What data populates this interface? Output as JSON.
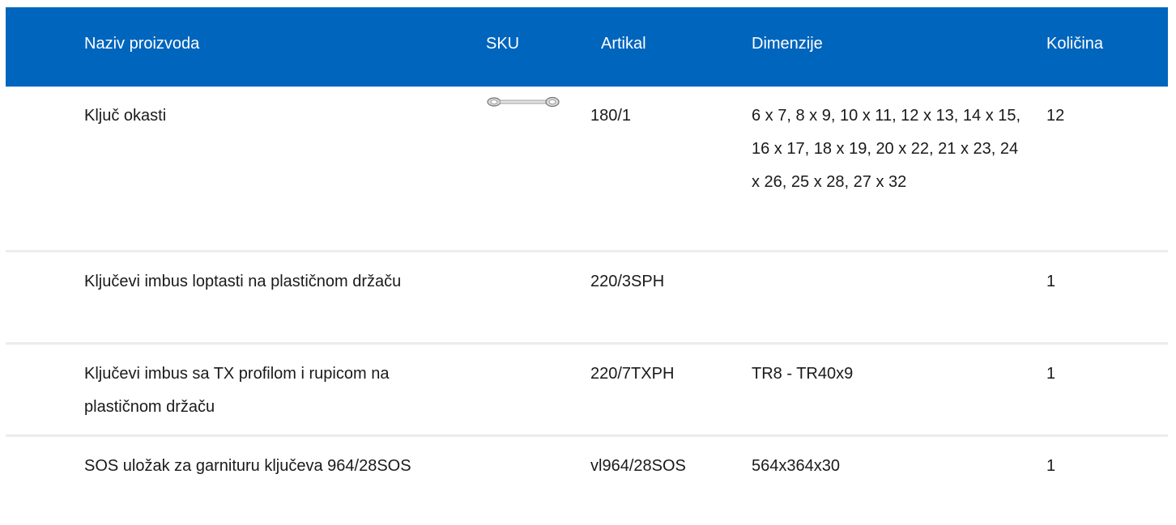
{
  "table": {
    "headers": {
      "name": "Naziv proizvoda",
      "sku": "SKU",
      "article": "Artikal",
      "dimensions": "Dimenzije",
      "quantity": "Količina"
    },
    "rows": [
      {
        "name": "Ključ okasti",
        "sku_icon": "ring-wrench-icon",
        "article": "180/1",
        "dimensions": "6 x 7, 8 x 9, 10 x 11, 12 x 13, 14 x 15, 16 x 17, 18 x 19, 20 x 22, 21 x 23, 24 x 26, 25 x 28, 27 x 32",
        "quantity": "12"
      },
      {
        "name": "Ključevi imbus loptasti na plastičnom držaču",
        "article": "220/3SPH",
        "dimensions": "",
        "quantity": "1"
      },
      {
        "name": "Ključevi imbus sa TX profilom i rupicom na plastičnom držaču",
        "article": "220/7TXPH",
        "dimensions": "TR8 - TR40x9",
        "quantity": "1"
      },
      {
        "name": "SOS uložak za garnituru ključeva 964/28SOS",
        "article": "vl964/28SOS",
        "dimensions": "564x364x30",
        "quantity": "1"
      }
    ]
  },
  "colors": {
    "header_bg": "#0065bd",
    "header_text": "#ffffff",
    "row_divider": "#ececec",
    "body_text": "#1a1a1a"
  }
}
